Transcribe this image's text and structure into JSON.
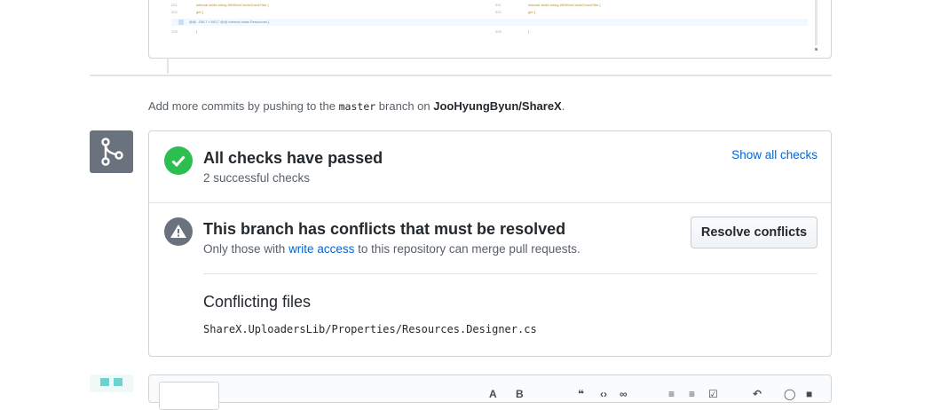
{
  "hint": {
    "prefix": "Add more commits by pushing to the",
    "branch": "master",
    "middle": "branch on",
    "repo": "JooHyungByun/ShareX",
    "suffix": "."
  },
  "checks": {
    "title": "All checks have passed",
    "subtitle": "2 successful checks",
    "show_all": "Show all checks",
    "status_color": "#2cbe4e"
  },
  "conflicts": {
    "title": "This branch has conflicts that must be resolved",
    "desc_prefix": "Only those with",
    "desc_link": "write access",
    "desc_suffix": "to this repository can merge pull requests.",
    "resolve_button": "Resolve conflicts",
    "files_heading": "Conflicting files",
    "files": [
      "ShareX.UploadersLib/Properties/Resources.Designer.cs"
    ]
  },
  "icons": {
    "merge": "git-merge-icon",
    "check": "check-icon",
    "alert": "alert-icon"
  }
}
